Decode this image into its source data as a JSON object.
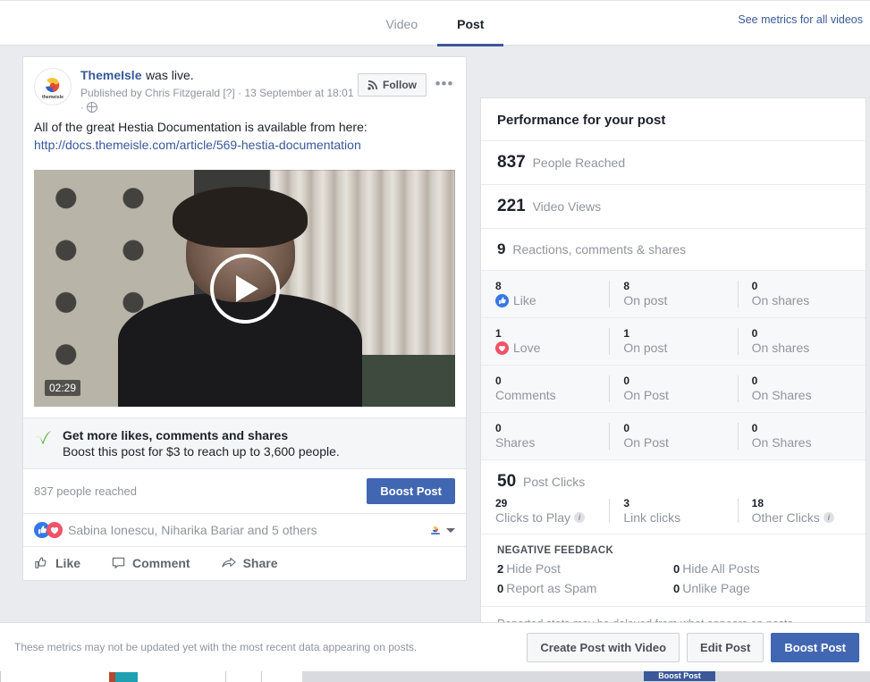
{
  "tabs": [
    {
      "label": "Video",
      "active": false
    },
    {
      "label": "Post",
      "active": true
    }
  ],
  "header": {
    "see_metrics_link": "See metrics for all videos"
  },
  "post": {
    "page_name": "ThemeIsle",
    "status_suffix": "was live.",
    "published_by": "Published by Chris Fitzgerald [?]",
    "separator_1": "·",
    "timestamp": "13 September at 18:01",
    "separator_2": "·",
    "privacy_icon": "globe-icon",
    "follow_label": "Follow",
    "follow_icon": "rss-icon",
    "more_options_icon": "ellipsis-icon",
    "message": "All of the great Hestia Documentation is available from here:",
    "link_text": "http://docs.themeisle.com/article/569-hestia-documentation",
    "video": {
      "duration": "02:29",
      "play_icon": "play-icon"
    },
    "promo": {
      "icon": "green-check-icon",
      "title": "Get more likes, comments and shares",
      "subtitle": "Boost this post for $3 to reach up to 3,600 people."
    },
    "reach": {
      "text": "837 people reached",
      "boost_label": "Boost Post"
    },
    "reactors": {
      "like_icon": "like-reaction-icon",
      "love_icon": "love-reaction-icon",
      "names": "Sabina Ionescu, Niharika Bariar and 5 others",
      "profile_icon": "themeisle-avatar-icon",
      "caret_icon": "chevron-down-icon"
    },
    "actions": [
      {
        "label": "Like",
        "icon": "thumbs-up-icon"
      },
      {
        "label": "Comment",
        "icon": "comment-bubble-icon"
      },
      {
        "label": "Share",
        "icon": "share-arrow-icon"
      }
    ]
  },
  "performance": {
    "title": "Performance for your post",
    "summary": [
      {
        "value": "837",
        "label": "People Reached"
      },
      {
        "value": "221",
        "label": "Video Views"
      },
      {
        "value": "9",
        "label": "Reactions, comments & shares"
      }
    ],
    "reaction_rows": [
      {
        "icon": "like-reaction-icon",
        "cells": [
          {
            "value": "8",
            "label": "Like"
          },
          {
            "value": "8",
            "label": "On post"
          },
          {
            "value": "0",
            "label": "On shares"
          }
        ]
      },
      {
        "icon": "love-reaction-icon",
        "cells": [
          {
            "value": "1",
            "label": "Love"
          },
          {
            "value": "1",
            "label": "On post"
          },
          {
            "value": "0",
            "label": "On shares"
          }
        ]
      },
      {
        "icon": "",
        "cells": [
          {
            "value": "0",
            "label": "Comments"
          },
          {
            "value": "0",
            "label": "On Post"
          },
          {
            "value": "0",
            "label": "On Shares"
          }
        ]
      },
      {
        "icon": "",
        "cells": [
          {
            "value": "0",
            "label": "Shares"
          },
          {
            "value": "0",
            "label": "On Post"
          },
          {
            "value": "0",
            "label": "On Shares"
          }
        ]
      }
    ],
    "post_clicks": {
      "value": "50",
      "label": "Post Clicks"
    },
    "click_breakdown": [
      {
        "value": "29",
        "label": "Clicks to Play",
        "info": true
      },
      {
        "value": "3",
        "label": "Link clicks",
        "info": false
      },
      {
        "value": "18",
        "label": "Other Clicks",
        "info": true
      }
    ],
    "negative_feedback_title": "NEGATIVE FEEDBACK",
    "negative_feedback": [
      {
        "value": "2",
        "label": "Hide Post"
      },
      {
        "value": "0",
        "label": "Hide All Posts"
      },
      {
        "value": "0",
        "label": "Report as Spam"
      },
      {
        "value": "0",
        "label": "Unlike Page"
      }
    ],
    "footnote": "Reported stats may be delayed from what appears on posts"
  },
  "footer": {
    "note": "These metrics may not be updated yet with the most recent data appearing on posts.",
    "buttons": [
      {
        "label": "Create Post with Video",
        "primary": false
      },
      {
        "label": "Edit Post",
        "primary": false
      },
      {
        "label": "Boost Post",
        "primary": true
      }
    ]
  },
  "background": {
    "boost_post_label": "Boost Post"
  },
  "colors": {
    "brand_blue": "#4267b2",
    "link_blue": "#365899",
    "tab_underline": "#3b5998",
    "like_blue": "#3578e5",
    "love_red": "#f25268",
    "muted_text": "#90949c",
    "page_bg": "#e9ebee"
  }
}
